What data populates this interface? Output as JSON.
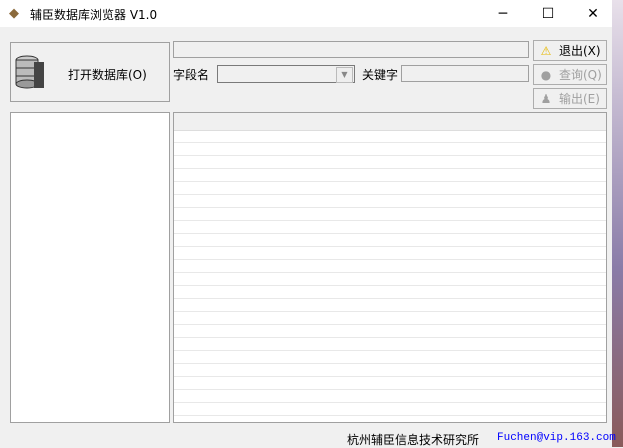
{
  "window": {
    "title": "辅臣数据库浏览器 V1.0",
    "minimize": "─",
    "maximize": "☐",
    "close": "✕"
  },
  "open_db": {
    "label": "打开数据库(O)"
  },
  "filter": {
    "field_label": "字段名",
    "field_value": "",
    "keyword_label": "关键字",
    "keyword_value": "",
    "status_value": ""
  },
  "buttons": {
    "exit": "退出(X)",
    "query": "查询(Q)",
    "export": "输出(E)"
  },
  "footer": {
    "company": "杭州辅臣信息技术研究所",
    "email": "Fuchen@vip.163.com"
  },
  "colors": {
    "email": "#0000ff"
  }
}
